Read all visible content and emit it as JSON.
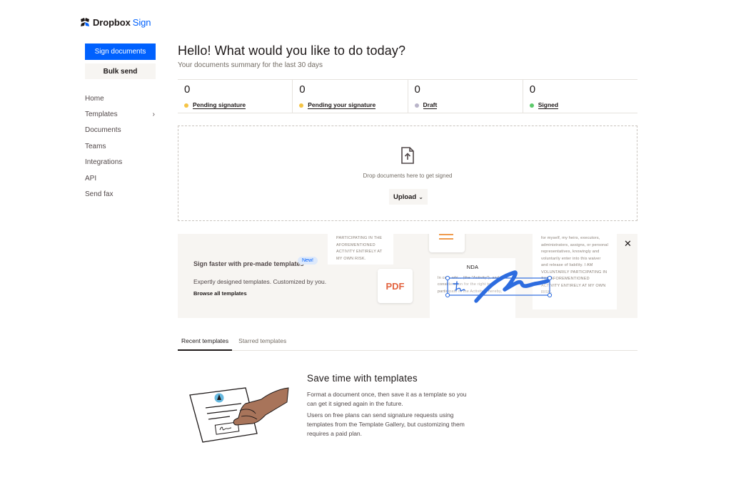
{
  "brand": {
    "name": "Dropbox",
    "product": "Sign",
    "accent": "#0061fe"
  },
  "sidebar": {
    "primary_button": "Sign documents",
    "secondary_button": "Bulk send",
    "items": [
      {
        "label": "Home"
      },
      {
        "label": "Templates",
        "icon": "chevron-right-icon"
      },
      {
        "label": "Documents"
      },
      {
        "label": "Teams"
      },
      {
        "label": "Integrations"
      },
      {
        "label": "API"
      },
      {
        "label": "Send fax"
      }
    ]
  },
  "header": {
    "title": "Hello! What would you like to do today?",
    "subtitle": "Your documents summary for the last 30 days"
  },
  "stats": [
    {
      "count": "0",
      "label": "Pending signature",
      "color": "#f5c445"
    },
    {
      "count": "0",
      "label": "Pending your signature",
      "color": "#f5c445"
    },
    {
      "count": "0",
      "label": "Draft",
      "color": "#b9b4c9"
    },
    {
      "count": "0",
      "label": "Signed",
      "color": "#5cc96b"
    }
  ],
  "dropzone": {
    "icon": "file-upload-icon",
    "text": "Drop documents here to get signed",
    "upload_label": "Upload"
  },
  "promo": {
    "title": "Sign faster with pre-made templates",
    "badge": "New!",
    "description": "Expertly designed templates. Customized by you.",
    "link": "Browse all templates",
    "cards": {
      "a": "PARTICIPATING IN THE AFOREMENTIONED ACTIVITY ENTIRELY AT MY OWN RISK.",
      "pdf": "PDF",
      "nda_title": "NDA",
      "nda_text": "In co... whi... (the \"Activity\"), and as consideration for the right to participate in the Activity, I hereby,",
      "c": "for myself, my heirs, executors, administrators, assigns, or personal representatives, knowingly and voluntarily enter into this waiver and release of liability. I AM VOLUNTARILY PARTICIPATING IN THE AFOREMENTIONED ACTIVITY ENTIRELY AT MY OWN RISK."
    }
  },
  "tabs": [
    {
      "label": "Recent templates",
      "active": true
    },
    {
      "label": "Starred templates",
      "active": false
    }
  ],
  "empty_state": {
    "title": "Save time with templates",
    "p1": "Format a document once, then save it as a template so you can get it signed again in the future.",
    "p2": "Users on free plans can send signature requests using templates from the Template Gallery, but customizing them requires a paid plan."
  }
}
